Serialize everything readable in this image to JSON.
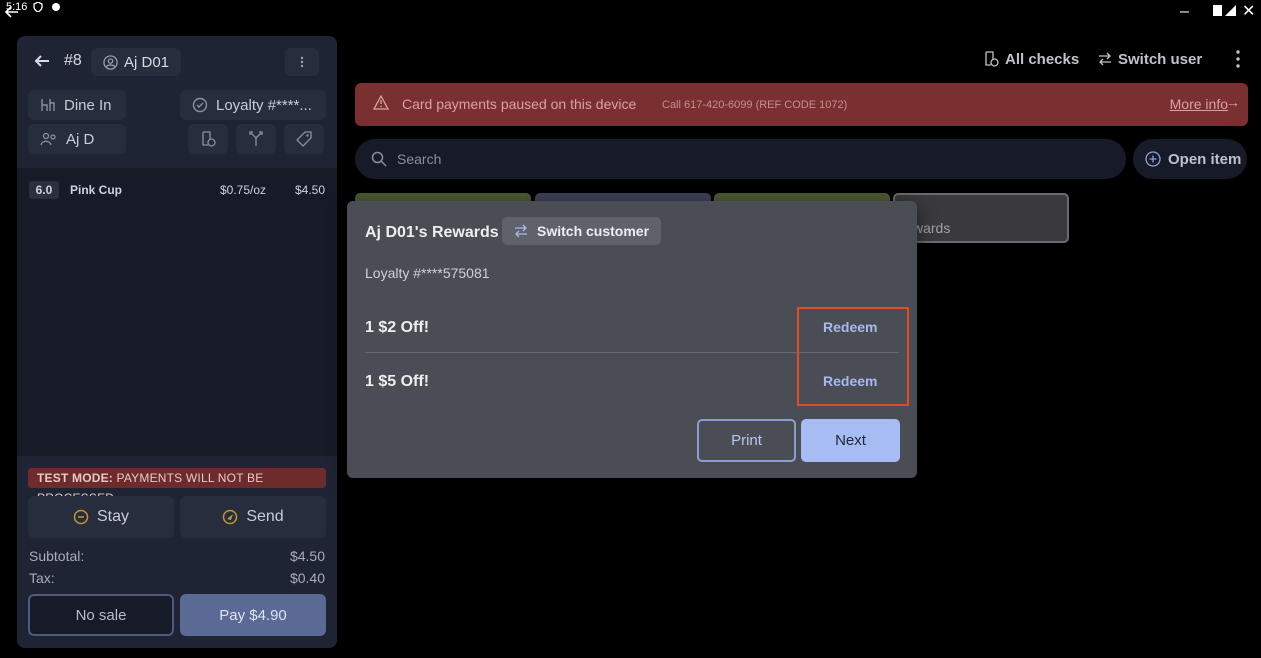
{
  "status_bar": {
    "time": "5:16"
  },
  "order": {
    "number": "#8",
    "customer_chip": "Aj D01",
    "dine_option": "Dine In",
    "loyalty_chip": "Loyalty #****...",
    "guest": "Aj D",
    "items": [
      {
        "qty": "6.0",
        "name": "Pink Cup",
        "unit_price": "$0.75/oz",
        "price": "$4.50"
      }
    ],
    "test_mode_label": "TEST MODE:",
    "test_mode_text": "PAYMENTS WILL NOT BE PROCESSED",
    "stay_label": "Stay",
    "send_label": "Send",
    "subtotal_label": "Subtotal:",
    "subtotal_value": "$4.50",
    "tax_label": "Tax:",
    "tax_value": "$0.40",
    "no_sale_label": "No sale",
    "pay_label": "Pay $4.90"
  },
  "header": {
    "all_checks": "All checks",
    "switch_user": "Switch user"
  },
  "banner": {
    "message": "Card payments paused on this device",
    "sub": "Call 617-420-6099 (REF CODE 1072)",
    "more_info": "More info"
  },
  "search": {
    "placeholder": "Search"
  },
  "open_item": "Open item",
  "categories": {
    "rewards_partial": "wards",
    "tile_colors": [
      "#4a5a33",
      "#3a4258",
      "#4a5a33"
    ]
  },
  "modal": {
    "title": "Aj D01's Rewards",
    "switch_customer": "Switch customer",
    "loyalty": "Loyalty #****575081",
    "rewards": [
      {
        "name": "1 $2 Off!",
        "action": "Redeem"
      },
      {
        "name": "1 $5 Off!",
        "action": "Redeem"
      }
    ],
    "print_label": "Print",
    "next_label": "Next"
  },
  "colors": {
    "banner": "#7a2f30",
    "accent": "#a8bcf4",
    "highlight": "#e44a2a"
  }
}
